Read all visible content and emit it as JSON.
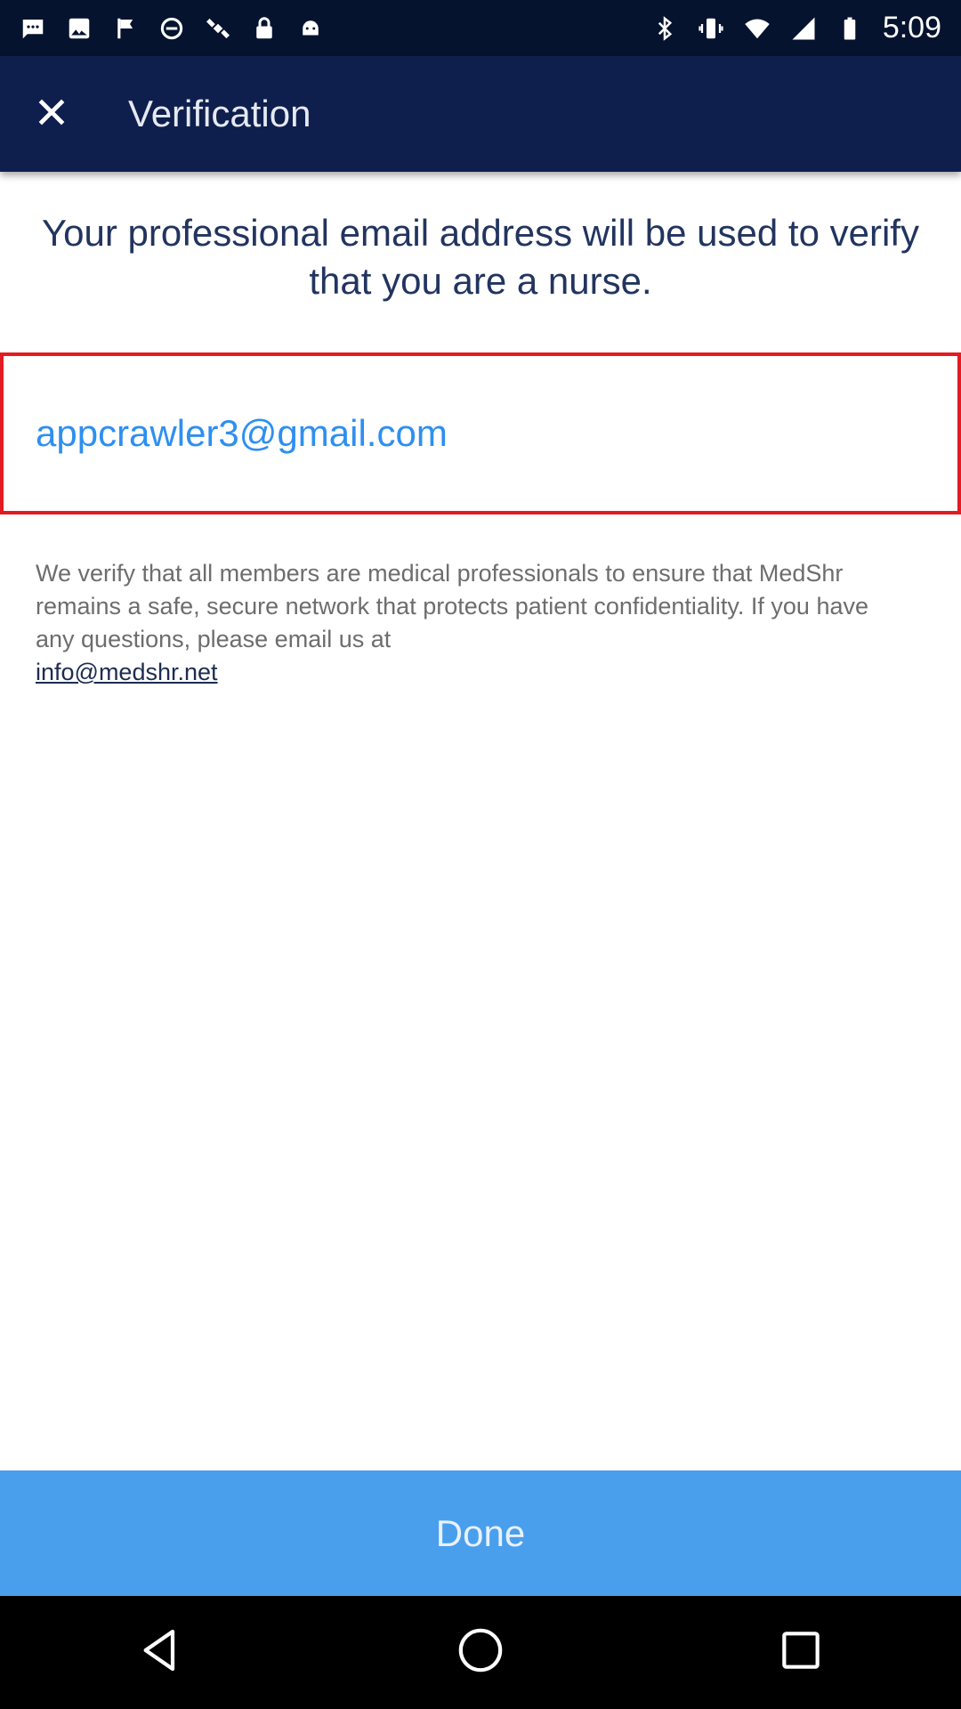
{
  "status_bar": {
    "time": "5:09",
    "left_icons": [
      "message-icon",
      "image-icon",
      "flag-icon",
      "block-icon",
      "satellite-icon",
      "lock-icon",
      "android-icon"
    ],
    "right_icons": [
      "bluetooth-icon",
      "vibrate-icon",
      "wifi-icon",
      "signal-icon",
      "battery-icon"
    ]
  },
  "app_bar": {
    "close_icon": "close-icon",
    "title": "Verification"
  },
  "intro_text": "Your professional email address will be used to verify that you are a nurse.",
  "email_field": {
    "value": "appcrawler3@gmail.com"
  },
  "info": {
    "text": "We verify that all members are medical professionals to ensure that MedShr remains a safe, secure network that protects patient confidentiality. If you have any questions, please email us at",
    "email_link": "info@medshr.net"
  },
  "done_button": {
    "label": "Done"
  },
  "nav_bar": {
    "icons": [
      "back-icon",
      "home-icon",
      "recents-icon"
    ]
  },
  "colors": {
    "status_bar_bg": "#06132f",
    "app_bar_bg": "#0e1f4d",
    "intro_text": "#22345f",
    "email_text": "#2e8ff0",
    "field_border": "#e31b23",
    "done_bg": "#4a9fed"
  }
}
